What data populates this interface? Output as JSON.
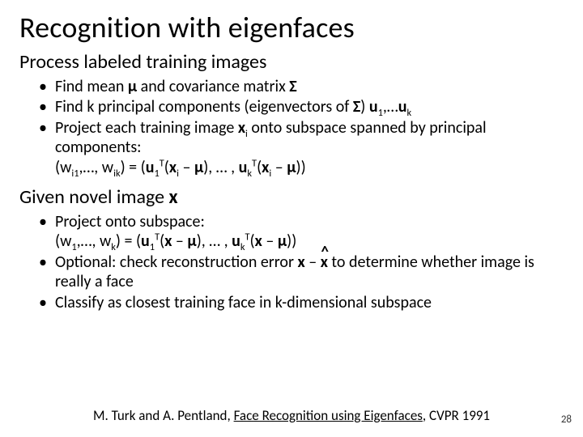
{
  "title": "Recognition with eigenfaces",
  "section1": {
    "heading": "Process labeled training images",
    "b1_pre": "Find mean ",
    "b1_mu": "μ",
    "b1_mid": " and covariance matrix ",
    "b1_sigma": "Σ",
    "b2_pre": "Find k principal components (eigenvectors of ",
    "b2_sigma": "Σ",
    "b2_post1": ") ",
    "b2_u": "u",
    "b2_s1": "1",
    "b2_mid": ",…",
    "b2_u2": "u",
    "b2_sk": "k",
    "b3_pre": "Project each training image ",
    "b3_x": "x",
    "b3_si": "i",
    "b3_post": " onto subspace spanned by principal components:",
    "b3l2_pre": "(w",
    "b3l2_s_i1": "i1",
    "b3l2_m1": ",…, w",
    "b3l2_s_ik": "ik",
    "b3l2_m2": ") = (",
    "b3l2_u": "u",
    "b3l2_s1": "1",
    "b3l2_T": "T",
    "b3l2_op": "(",
    "b3l2_x": "x",
    "b3l2_si": "i",
    "b3l2_minus": " – ",
    "b3l2_mu": "μ",
    "b3l2_cp": ")",
    "b3l2_m3": ", … , ",
    "b3l2_u2": "u",
    "b3l2_sk": "k",
    "b3l2_T2": "T",
    "b3l2_op2": "(",
    "b3l2_x2": "x",
    "b3l2_si2": "i",
    "b3l2_minus2": " – ",
    "b3l2_mu2": "μ",
    "b3l2_cp2": "))"
  },
  "section2": {
    "heading_pre": "Given novel image ",
    "heading_x": "x",
    "b1_t1": "Project onto subspace:",
    "b1l2_pre": "(w",
    "b1l2_s1": "1",
    "b1l2_m1": ",…, w",
    "b1l2_sk": "k",
    "b1l2_m2": ") = (",
    "b1l2_u": "u",
    "b1l2_us1": "1",
    "b1l2_T": "T",
    "b1l2_op": "(",
    "b1l2_x": "x",
    "b1l2_minus": " – ",
    "b1l2_mu": "μ",
    "b1l2_cp": ")",
    "b1l2_m3": ", … , ",
    "b1l2_u2": "u",
    "b1l2_usk": "k",
    "b1l2_T2": "T",
    "b1l2_op2": "(",
    "b1l2_x2": "x",
    "b1l2_minus2": " – ",
    "b1l2_mu2": "μ",
    "b1l2_cp2": "))",
    "b2_pre": "Optional: check reconstruction error ",
    "b2_x": "x",
    "b2_minus": " – ",
    "b2_hat": "^",
    "b2_xhat": "x",
    "b2_post": " to determine whether image is really a face",
    "b3": "Classify as closest training face in k-dimensional subspace"
  },
  "footer": {
    "pre": "M. Turk and A. Pentland, ",
    "link": "Face Recognition using Eigenfaces",
    "post": ", CVPR 1991"
  },
  "pagenum": "28"
}
